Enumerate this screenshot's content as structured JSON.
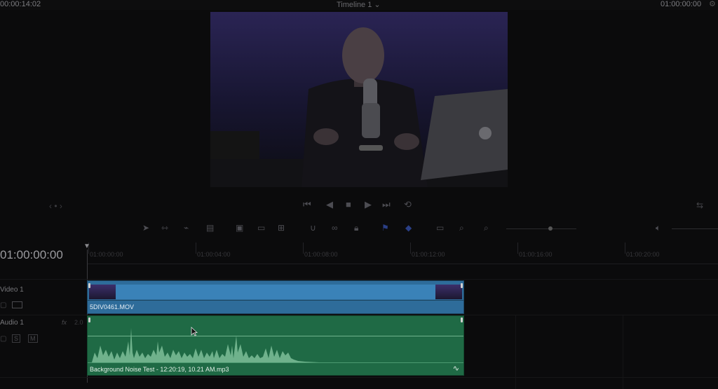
{
  "topbar": {
    "timecode_left": "00:00:14:02",
    "timeline_name": "Timeline 1 ⌄",
    "timecode_right": "01:00:00:00",
    "gear_icon": "gear-icon"
  },
  "playhead_timecode": "01:00:00:00",
  "ruler": {
    "ticks": [
      "01:00:00:00",
      "01:00:04:00",
      "01:00:08:00",
      "01:00:12:00",
      "01:00:16:00",
      "01:00:20:00"
    ]
  },
  "tracks": {
    "video": {
      "name": "Video 1"
    },
    "audio": {
      "name": "Audio 1",
      "fx": "fx",
      "level": "2.0"
    }
  },
  "clips": {
    "video": {
      "name": "5DIV0461.MOV",
      "color": "#2e6c9a"
    },
    "audio": {
      "name": "Background Noise Test - 12:20:19, 10.21 AM.mp3",
      "color": "#1f6a45"
    }
  },
  "icons": {
    "transport": [
      "skip-back-icon",
      "step-back-icon",
      "stop-icon",
      "play-icon",
      "skip-forward-icon",
      "loop-icon"
    ],
    "toolbar": [
      "pointer-icon",
      "trim-icon",
      "blade-icon",
      "dynamic-trim-icon",
      "insert-icon",
      "overwrite-icon",
      "replace-icon",
      "snap-icon",
      "link-icon",
      "lock-icon",
      "flag-icon",
      "marker-icon",
      "zoom-full-icon",
      "zoom-detail-icon",
      "zoom-custom-icon",
      "volume-icon"
    ]
  }
}
